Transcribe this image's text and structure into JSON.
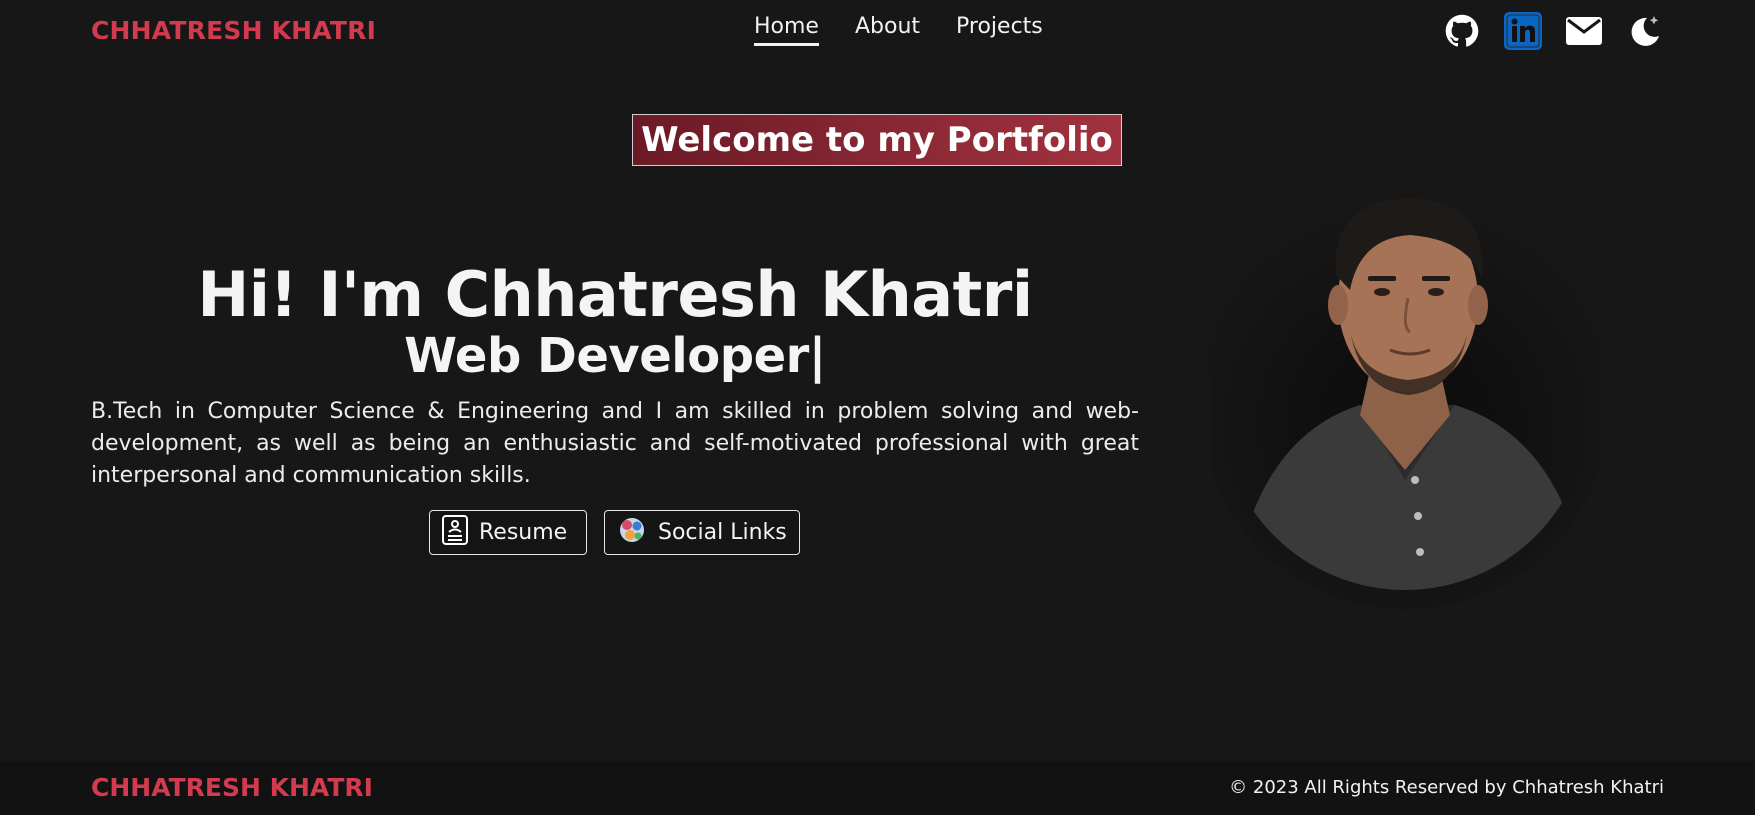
{
  "header": {
    "brand": "CHHATRESH KHATRI",
    "nav": [
      {
        "label": "Home",
        "active": true
      },
      {
        "label": "About",
        "active": false
      },
      {
        "label": "Projects",
        "active": false
      }
    ],
    "icons": [
      "github-icon",
      "linkedin-icon",
      "mail-icon",
      "dark-mode-icon"
    ]
  },
  "main": {
    "welcome": "Welcome to my Portfolio",
    "title": "Hi! I'm Chhatresh Khatri",
    "role": "Web Developer|",
    "description": "B.Tech in Computer Science & Engineering and I am skilled in problem solving and web-development, as well as being an enthusiastic and self-motivated professional with great interpersonal and communication skills.",
    "buttons": [
      {
        "label": "Resume",
        "icon": "resume-icon"
      },
      {
        "label": "Social Links",
        "icon": "social-links-icon"
      }
    ]
  },
  "footer": {
    "brand": "CHHATRESH KHATRI",
    "copyright": "© 2023 All Rights Reserved by Chhatresh Khatri"
  },
  "colors": {
    "background": "#171717",
    "accent": "#d13a4f",
    "linkedin": "#0a66c2",
    "welcome_bg": "#8d2936"
  }
}
